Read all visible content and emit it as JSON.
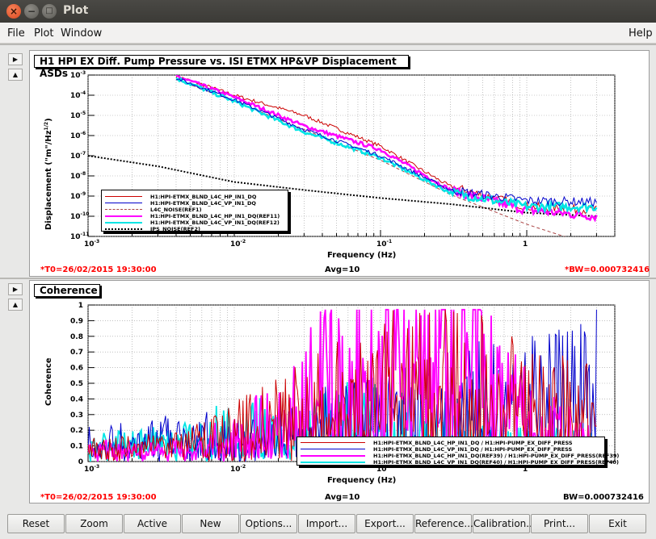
{
  "window": {
    "title": "Plot"
  },
  "menu": {
    "file": "File",
    "plot": "Plot",
    "window": "Window",
    "help": "Help"
  },
  "top_pad": {
    "title": "H1 HPI EX Diff. Pump Pressure vs. ISI ETMX HP&VP Displacement ASDs",
    "ylabel": "Displacement (\"m\"/Hz",
    "ylabel_exp": "1/2",
    "xlabel": "Frequency (Hz)",
    "t0": "*T0=26/02/2015 19:30:00",
    "avg": "Avg=10",
    "bw": "*BW=0.000732416",
    "xticks": [
      "10",
      "10",
      "10",
      "1"
    ],
    "xtick_exps": [
      "-3",
      "-2",
      "-1",
      ""
    ],
    "yticks": [
      "10",
      "10",
      "10",
      "10",
      "10",
      "10",
      "10",
      "10",
      "10"
    ],
    "ytick_exps": [
      "-3",
      "-4",
      "-5",
      "-6",
      "-7",
      "-8",
      "-9",
      "-10",
      "-11"
    ],
    "legend": [
      {
        "label": "H1:HPI-ETMX_BLND_L4C_HP_IN1_DQ",
        "color": "#cc0000",
        "style": "solid"
      },
      {
        "label": "H1:HPI-ETMX_BLND_L4C_VP_IN1_DQ",
        "color": "#0000cc",
        "style": "solid"
      },
      {
        "label": "L4C_NOISE(REF1)",
        "color": "#aa4444",
        "style": "dashed"
      },
      {
        "label": "H1:HPI-ETMX_BLND_L4C_HP_IN1_DQ(REF11)",
        "color": "#ff00ff",
        "style": "thick"
      },
      {
        "label": "H1:HPI-ETMX_BLND_L4C_VP_IN1_DQ(REF12)",
        "color": "#00e5e5",
        "style": "thick"
      },
      {
        "label": "IPS_NOISE(REF2)",
        "color": "#000000",
        "style": "dotted"
      }
    ]
  },
  "bottom_pad": {
    "title": "Coherence",
    "ylabel": "Coherence",
    "xlabel": "Frequency (Hz)",
    "t0": "*T0=26/02/2015 19:30:00",
    "avg": "Avg=10",
    "bw": "BW=0.000732416",
    "xticks": [
      "10",
      "10",
      "10",
      "1"
    ],
    "xtick_exps": [
      "-3",
      "-2",
      "-1",
      ""
    ],
    "yticks": [
      "1",
      "0.9",
      "0.8",
      "0.7",
      "0.6",
      "0.5",
      "0.4",
      "0.3",
      "0.2",
      "0.1",
      "0"
    ],
    "legend": [
      {
        "label": "H1:HPI-ETMX_BLND_L4C_HP_IN1_DQ / H1:HPI-PUMP_EX_DIFF_PRESS",
        "color": "#cc0000",
        "style": "solid"
      },
      {
        "label": "H1:HPI-ETMX_BLND_L4C_VP_IN1_DQ / H1:HPI-PUMP_EX_DIFF_PRESS",
        "color": "#0000cc",
        "style": "solid"
      },
      {
        "label": "H1:HPI-ETMX_BLND_L4C_HP_IN1_DQ(REF39) / H1:HPI-PUMP_EX_DIFF_PRESS(REF39)",
        "color": "#ff00ff",
        "style": "thick"
      },
      {
        "label": "H1:HPI-ETMX_BLND_L4C_VP_IN1_DQ(REF40) / H1:HPI-PUMP_EX_DIFF_PRESS(REF40)",
        "color": "#00e5e5",
        "style": "thick"
      }
    ]
  },
  "buttons": [
    "Reset",
    "Zoom",
    "Active",
    "New",
    "Options...",
    "Import...",
    "Export...",
    "Reference...",
    "Calibration...",
    "Print...",
    "Exit"
  ],
  "chart_data": [
    {
      "type": "line",
      "title": "H1 HPI EX Diff. Pump Pressure vs. ISI ETMX HP&VP Displacement ASDs",
      "xlabel": "Frequency (Hz)",
      "ylabel": "Displacement (\"m\"/Hz^1/2)",
      "xscale": "log",
      "yscale": "log",
      "xlim": [
        0.001,
        4
      ],
      "ylim": [
        1e-11,
        0.001
      ],
      "grid": true,
      "legend_position": "bottom-left",
      "series": [
        {
          "name": "H1:HPI-ETMX_BLND_L4C_HP_IN1_DQ",
          "x": [
            0.004,
            0.01,
            0.03,
            0.1,
            0.3,
            1,
            3
          ],
          "y": [
            0.0009,
            0.0001,
            1e-05,
            3e-07,
            3e-09,
            3e-10,
            2e-10
          ]
        },
        {
          "name": "H1:HPI-ETMX_BLND_L4C_VP_IN1_DQ",
          "x": [
            0.004,
            0.01,
            0.03,
            0.1,
            0.3,
            1,
            3
          ],
          "y": [
            0.0007,
            6e-05,
            2e-06,
            1e-07,
            2e-09,
            6e-10,
            5e-10
          ]
        },
        {
          "name": "L4C_NOISE(REF1)",
          "x": [
            0.004,
            0.01,
            0.03,
            0.1,
            0.3,
            1,
            3
          ],
          "y": [
            0.0006,
            5e-05,
            2e-06,
            6e-08,
            1.2e-09,
            4e-11,
            3e-12
          ]
        },
        {
          "name": "H1:HPI-ETMX_BLND_L4C_HP_IN1_DQ(REF11)",
          "x": [
            0.004,
            0.01,
            0.03,
            0.1,
            0.3,
            1,
            3
          ],
          "y": [
            0.0009,
            8e-05,
            3e-06,
            2e-07,
            2e-09,
            2e-10,
            1e-10
          ]
        },
        {
          "name": "H1:HPI-ETMX_BLND_L4C_VP_IN1_DQ(REF12)",
          "x": [
            0.004,
            0.01,
            0.03,
            0.1,
            0.3,
            1,
            3
          ],
          "y": [
            0.0007,
            5e-05,
            1.5e-06,
            8e-08,
            1.5e-09,
            3e-10,
            3e-10
          ]
        },
        {
          "name": "IPS_NOISE(REF2)",
          "x": [
            0.001,
            0.003,
            0.01,
            0.03,
            0.1,
            0.3,
            1,
            3
          ],
          "y": [
            1e-07,
            3e-08,
            5e-09,
            2e-09,
            8e-10,
            4e-10,
            1.5e-10,
            1e-10
          ]
        }
      ]
    },
    {
      "type": "line",
      "title": "Coherence",
      "xlabel": "Frequency (Hz)",
      "ylabel": "Coherence",
      "xscale": "log",
      "xlim": [
        0.001,
        4
      ],
      "ylim": [
        0,
        1
      ],
      "grid": true,
      "legend_position": "bottom-right",
      "series": [
        {
          "name": "H1:HPI-ETMX_BLND_L4C_HP_IN1_DQ / H1:HPI-PUMP_EX_DIFF_PRESS",
          "x": [
            0.001,
            0.003,
            0.01,
            0.03,
            0.1,
            0.3,
            1,
            3
          ],
          "y": [
            0.1,
            0.12,
            0.2,
            0.35,
            0.5,
            0.6,
            0.4,
            0.35
          ]
        },
        {
          "name": "H1:HPI-ETMX_BLND_L4C_VP_IN1_DQ / H1:HPI-PUMP_EX_DIFF_PRESS",
          "x": [
            0.001,
            0.003,
            0.01,
            0.03,
            0.1,
            0.3,
            1,
            3
          ],
          "y": [
            0.15,
            0.2,
            0.15,
            0.25,
            0.3,
            0.4,
            0.45,
            0.55
          ]
        },
        {
          "name": "H1:HPI-ETMX_BLND_L4C_HP_IN1_DQ(REF39) / H1:HPI-PUMP_EX_DIFF_PRESS(REF39)",
          "x": [
            0.001,
            0.003,
            0.01,
            0.03,
            0.1,
            0.3,
            1,
            3
          ],
          "y": [
            0.1,
            0.08,
            0.15,
            0.45,
            0.75,
            0.8,
            0.3,
            0.12
          ]
        },
        {
          "name": "H1:HPI-ETMX_BLND_L4C_VP_IN1_DQ(REF40) / H1:HPI-PUMP_EX_DIFF_PRESS(REF40)",
          "x": [
            0.001,
            0.003,
            0.01,
            0.03,
            0.1,
            0.3,
            1,
            3
          ],
          "y": [
            0.12,
            0.15,
            0.2,
            0.25,
            0.3,
            0.2,
            0.12,
            0.1
          ]
        }
      ]
    }
  ]
}
